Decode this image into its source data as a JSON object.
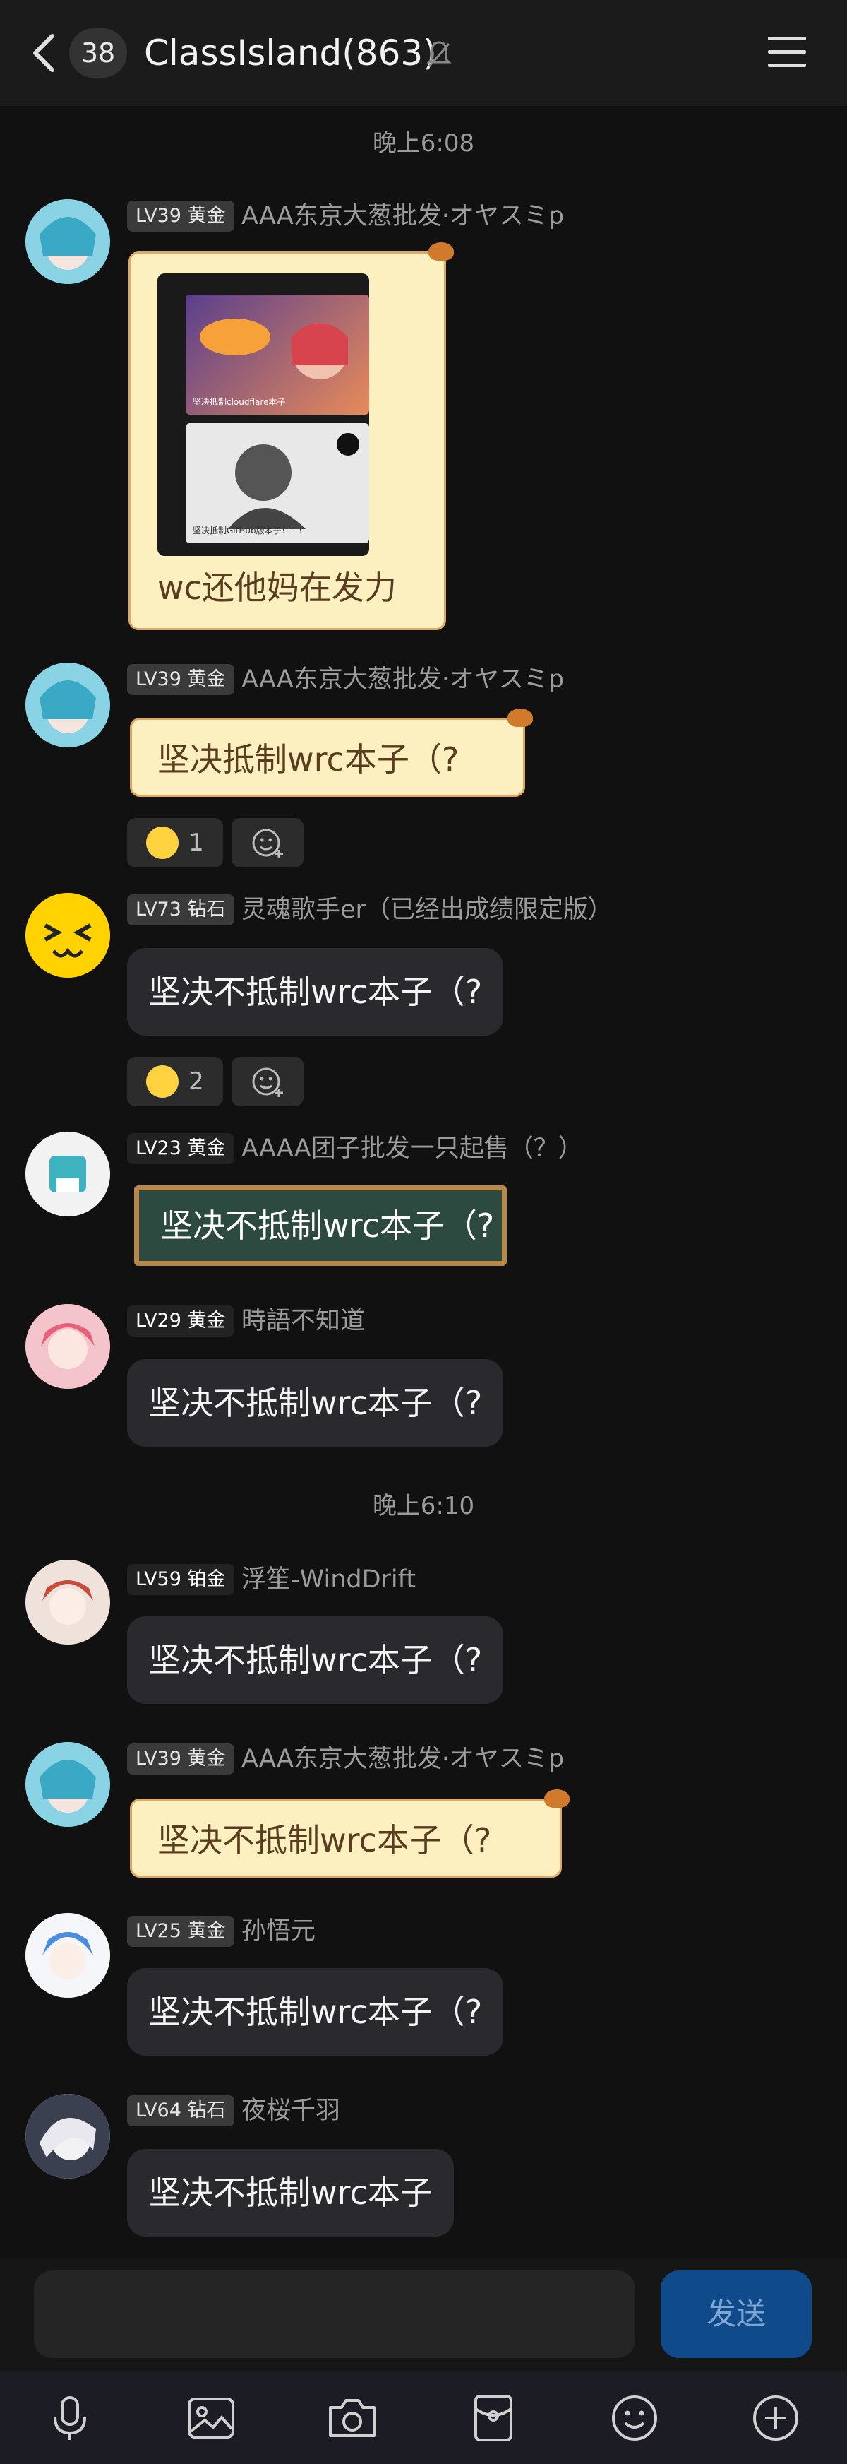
{
  "header": {
    "unread": "38",
    "title": "ClassIsland(863)"
  },
  "times": [
    "晚上6:08",
    "晚上6:10"
  ],
  "messages": [
    {
      "level": "LV39 黄金",
      "user": "AAA东京大葱批发·オヤスミp",
      "text": "wc还他妈在发力",
      "images": [
        "坚决抵制cloudflare本子",
        "坚决抵制GitHub版本子！！！"
      ]
    },
    {
      "level": "LV39 黄金",
      "user": "AAA东京大葱批发·オヤスミp",
      "text": "坚决抵制wrc本子（?",
      "reaction_count": "1"
    },
    {
      "level": "LV73 钻石",
      "user": "灵魂歌手er（已经出成绩限定版）",
      "text": "坚决不抵制wrc本子（?",
      "reaction_count": "2"
    },
    {
      "level": "LV23 黄金",
      "user": "AAAA团子批发一只起售（？）",
      "text": "坚决不抵制wrc本子（?"
    },
    {
      "level": "LV29 黄金",
      "user": "時語不知道",
      "text": "坚决不抵制wrc本子（?"
    },
    {
      "level": "LV59 铂金",
      "user": "浮笙-WindDrift",
      "text": "坚决不抵制wrc本子（?"
    },
    {
      "level": "LV39 黄金",
      "user": "AAA东京大葱批发·オヤスミp",
      "text": "坚决不抵制wrc本子（?"
    },
    {
      "level": "LV25 黄金",
      "user": "孙悟元",
      "text": "坚决不抵制wrc本子（?"
    },
    {
      "level": "LV64 钻石",
      "user": "夜桜千羽",
      "text": "坚决不抵制wrc本子"
    }
  ],
  "input": {
    "send_label": "发送"
  },
  "toolbar": [
    "microphone-icon",
    "image-icon",
    "camera-icon",
    "red-packet-icon",
    "emoji-icon",
    "plus-icon"
  ]
}
